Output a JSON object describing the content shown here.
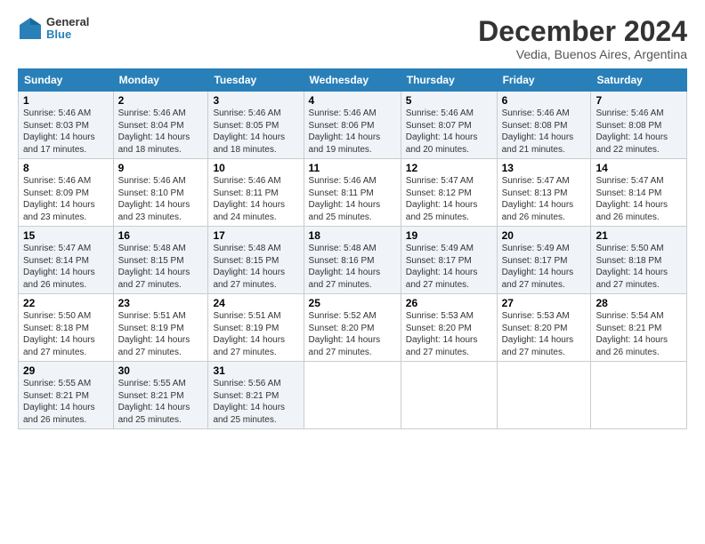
{
  "logo": {
    "line1": "General",
    "line2": "Blue"
  },
  "title": "December 2024",
  "subtitle": "Vedia, Buenos Aires, Argentina",
  "days_of_week": [
    "Sunday",
    "Monday",
    "Tuesday",
    "Wednesday",
    "Thursday",
    "Friday",
    "Saturday"
  ],
  "weeks": [
    [
      {
        "day": "1",
        "info": "Sunrise: 5:46 AM\nSunset: 8:03 PM\nDaylight: 14 hours\nand 17 minutes."
      },
      {
        "day": "2",
        "info": "Sunrise: 5:46 AM\nSunset: 8:04 PM\nDaylight: 14 hours\nand 18 minutes."
      },
      {
        "day": "3",
        "info": "Sunrise: 5:46 AM\nSunset: 8:05 PM\nDaylight: 14 hours\nand 18 minutes."
      },
      {
        "day": "4",
        "info": "Sunrise: 5:46 AM\nSunset: 8:06 PM\nDaylight: 14 hours\nand 19 minutes."
      },
      {
        "day": "5",
        "info": "Sunrise: 5:46 AM\nSunset: 8:07 PM\nDaylight: 14 hours\nand 20 minutes."
      },
      {
        "day": "6",
        "info": "Sunrise: 5:46 AM\nSunset: 8:08 PM\nDaylight: 14 hours\nand 21 minutes."
      },
      {
        "day": "7",
        "info": "Sunrise: 5:46 AM\nSunset: 8:08 PM\nDaylight: 14 hours\nand 22 minutes."
      }
    ],
    [
      {
        "day": "8",
        "info": "Sunrise: 5:46 AM\nSunset: 8:09 PM\nDaylight: 14 hours\nand 23 minutes."
      },
      {
        "day": "9",
        "info": "Sunrise: 5:46 AM\nSunset: 8:10 PM\nDaylight: 14 hours\nand 23 minutes."
      },
      {
        "day": "10",
        "info": "Sunrise: 5:46 AM\nSunset: 8:11 PM\nDaylight: 14 hours\nand 24 minutes."
      },
      {
        "day": "11",
        "info": "Sunrise: 5:46 AM\nSunset: 8:11 PM\nDaylight: 14 hours\nand 25 minutes."
      },
      {
        "day": "12",
        "info": "Sunrise: 5:47 AM\nSunset: 8:12 PM\nDaylight: 14 hours\nand 25 minutes."
      },
      {
        "day": "13",
        "info": "Sunrise: 5:47 AM\nSunset: 8:13 PM\nDaylight: 14 hours\nand 26 minutes."
      },
      {
        "day": "14",
        "info": "Sunrise: 5:47 AM\nSunset: 8:14 PM\nDaylight: 14 hours\nand 26 minutes."
      }
    ],
    [
      {
        "day": "15",
        "info": "Sunrise: 5:47 AM\nSunset: 8:14 PM\nDaylight: 14 hours\nand 26 minutes."
      },
      {
        "day": "16",
        "info": "Sunrise: 5:48 AM\nSunset: 8:15 PM\nDaylight: 14 hours\nand 27 minutes."
      },
      {
        "day": "17",
        "info": "Sunrise: 5:48 AM\nSunset: 8:15 PM\nDaylight: 14 hours\nand 27 minutes."
      },
      {
        "day": "18",
        "info": "Sunrise: 5:48 AM\nSunset: 8:16 PM\nDaylight: 14 hours\nand 27 minutes."
      },
      {
        "day": "19",
        "info": "Sunrise: 5:49 AM\nSunset: 8:17 PM\nDaylight: 14 hours\nand 27 minutes."
      },
      {
        "day": "20",
        "info": "Sunrise: 5:49 AM\nSunset: 8:17 PM\nDaylight: 14 hours\nand 27 minutes."
      },
      {
        "day": "21",
        "info": "Sunrise: 5:50 AM\nSunset: 8:18 PM\nDaylight: 14 hours\nand 27 minutes."
      }
    ],
    [
      {
        "day": "22",
        "info": "Sunrise: 5:50 AM\nSunset: 8:18 PM\nDaylight: 14 hours\nand 27 minutes."
      },
      {
        "day": "23",
        "info": "Sunrise: 5:51 AM\nSunset: 8:19 PM\nDaylight: 14 hours\nand 27 minutes."
      },
      {
        "day": "24",
        "info": "Sunrise: 5:51 AM\nSunset: 8:19 PM\nDaylight: 14 hours\nand 27 minutes."
      },
      {
        "day": "25",
        "info": "Sunrise: 5:52 AM\nSunset: 8:20 PM\nDaylight: 14 hours\nand 27 minutes."
      },
      {
        "day": "26",
        "info": "Sunrise: 5:53 AM\nSunset: 8:20 PM\nDaylight: 14 hours\nand 27 minutes."
      },
      {
        "day": "27",
        "info": "Sunrise: 5:53 AM\nSunset: 8:20 PM\nDaylight: 14 hours\nand 27 minutes."
      },
      {
        "day": "28",
        "info": "Sunrise: 5:54 AM\nSunset: 8:21 PM\nDaylight: 14 hours\nand 26 minutes."
      }
    ],
    [
      {
        "day": "29",
        "info": "Sunrise: 5:55 AM\nSunset: 8:21 PM\nDaylight: 14 hours\nand 26 minutes."
      },
      {
        "day": "30",
        "info": "Sunrise: 5:55 AM\nSunset: 8:21 PM\nDaylight: 14 hours\nand 25 minutes."
      },
      {
        "day": "31",
        "info": "Sunrise: 5:56 AM\nSunset: 8:21 PM\nDaylight: 14 hours\nand 25 minutes."
      },
      null,
      null,
      null,
      null
    ]
  ]
}
